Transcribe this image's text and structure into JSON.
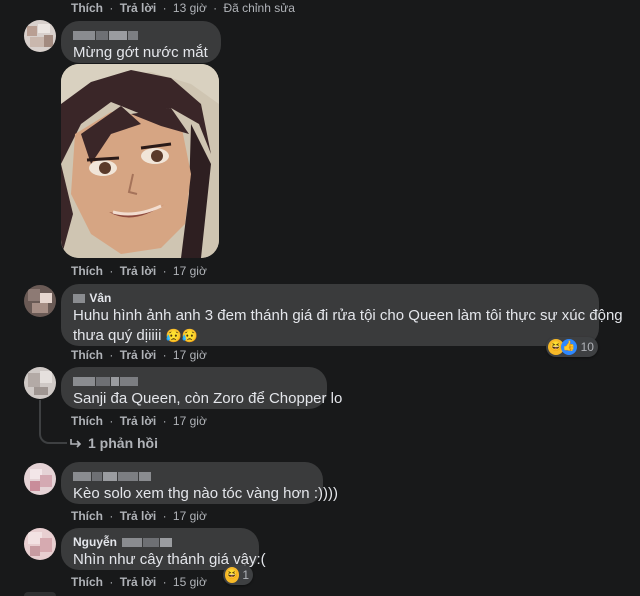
{
  "actions": {
    "like": "Thích",
    "reply": "Trả lời",
    "separator": "·"
  },
  "comments": [
    {
      "time": "13 giờ",
      "edited": "Đã chỉnh sửa"
    },
    {
      "name": "",
      "text": "Mừng gớt nước mắt",
      "time": "17 giờ",
      "has_photo": true
    },
    {
      "name": "Vân",
      "text_line1": "Huhu hình ảnh anh 3 đem thánh giá đi rửa tội cho Queen làm tôi thực sự xúc động",
      "text_line2": "thưa quý dịiiii",
      "emoji": "😥😥",
      "time": "17 giờ",
      "reaction_count": "10"
    },
    {
      "name": "",
      "text": "Sanji đa Queen, còn Zoro để Chopper lo",
      "time": "17 giờ",
      "replies_label": "1 phản hồi"
    },
    {
      "name": "",
      "text": "Kèo solo xem thg nào tóc vàng hơn :))))",
      "time": "17 giờ"
    },
    {
      "name": "Nguyễn",
      "text": "Nhìn như cây thánh giá vậy:(",
      "time": "15 giờ",
      "reaction_count": "1"
    }
  ],
  "colors": {
    "background": "#18191a",
    "bubble": "#3a3b3c",
    "text": "#e4e6eb",
    "secondary": "#b0b3b8",
    "like_blue": "#2d88ff",
    "haha_yellow": "#f7b928"
  },
  "icons": {
    "reply_arrow": "reply-arrow-icon",
    "like": "like-reaction-icon",
    "haha": "haha-reaction-icon"
  }
}
